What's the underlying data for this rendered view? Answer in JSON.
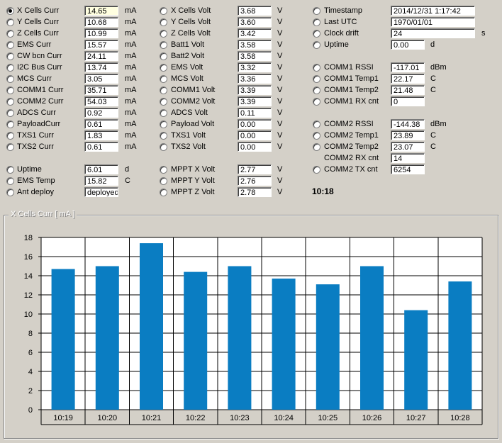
{
  "col1": [
    {
      "label": "X Cells Curr",
      "value": "14.65",
      "unit": "mA",
      "selected": true,
      "highlight": true
    },
    {
      "label": "Y Cells Curr",
      "value": "10.68",
      "unit": "mA"
    },
    {
      "label": "Z Cells Curr",
      "value": "10.99",
      "unit": "mA"
    },
    {
      "label": "EMS Curr",
      "value": "15.57",
      "unit": "mA"
    },
    {
      "label": "CW bcn Curr",
      "value": "24.11",
      "unit": "mA"
    },
    {
      "label": "I2C Bus Curr",
      "value": "13.74",
      "unit": "mA"
    },
    {
      "label": "MCS Curr",
      "value": "3.05",
      "unit": "mA"
    },
    {
      "label": "COMM1 Curr",
      "value": "35.71",
      "unit": "mA"
    },
    {
      "label": "COMM2 Curr",
      "value": "54.03",
      "unit": "mA"
    },
    {
      "label": "ADCS Curr",
      "value": "0.92",
      "unit": "mA"
    },
    {
      "label": "PayloadCurr",
      "value": "0.61",
      "unit": "mA"
    },
    {
      "label": "TXS1 Curr",
      "value": "1.83",
      "unit": "mA"
    },
    {
      "label": "TXS2 Curr",
      "value": "0.61",
      "unit": "mA"
    }
  ],
  "col1b": [
    {
      "label": "Uptime",
      "value": "6.01",
      "unit": "d"
    },
    {
      "label": "EMS Temp",
      "value": "15.82",
      "unit": "C"
    },
    {
      "label": "Ant deploy",
      "value": "deployed",
      "unit": ""
    }
  ],
  "col2": [
    {
      "label": "X Cells Volt",
      "value": "3.68",
      "unit": "V"
    },
    {
      "label": "Y Cells Volt",
      "value": "3.60",
      "unit": "V"
    },
    {
      "label": "Z Cells Volt",
      "value": "3.42",
      "unit": "V"
    },
    {
      "label": "Batt1 Volt",
      "value": "3.58",
      "unit": "V"
    },
    {
      "label": "Batt2 Volt",
      "value": "3.58",
      "unit": "V"
    },
    {
      "label": "EMS Volt",
      "value": "3.32",
      "unit": "V"
    },
    {
      "label": "MCS Volt",
      "value": "3.36",
      "unit": "V"
    },
    {
      "label": "COMM1 Volt",
      "value": "3.39",
      "unit": "V"
    },
    {
      "label": "COMM2 Volt",
      "value": "3.39",
      "unit": "V"
    },
    {
      "label": "ADCS Volt",
      "value": "0.11",
      "unit": "V"
    },
    {
      "label": "Payload Volt",
      "value": "0.00",
      "unit": "V"
    },
    {
      "label": "TXS1 Volt",
      "value": "0.00",
      "unit": "V"
    },
    {
      "label": "TXS2 Volt",
      "value": "0.00",
      "unit": "V"
    }
  ],
  "col2b": [
    {
      "label": "MPPT X Volt",
      "value": "2.77",
      "unit": "V"
    },
    {
      "label": "MPPT Y Volt",
      "value": "2.76",
      "unit": "V"
    },
    {
      "label": "MPPT Z Volt",
      "value": "2.78",
      "unit": "V"
    }
  ],
  "col3a": [
    {
      "label": "Timestamp",
      "value": "2014/12/31 1:17:42",
      "unit": "",
      "radio": true
    },
    {
      "label": "Last UTC",
      "value": "1970/01/01",
      "unit": "",
      "radio": true
    },
    {
      "label": "Clock drift",
      "value": "24",
      "unit": "s",
      "radio": true
    },
    {
      "label": "Uptime",
      "value": "0.00",
      "unit": "d",
      "radio": true
    }
  ],
  "col3b": [
    {
      "label": "COMM1 RSSI",
      "value": "-117.01",
      "unit": "dBm",
      "radio": true
    },
    {
      "label": "COMM1 Temp1",
      "value": "22.17",
      "unit": "C",
      "radio": true
    },
    {
      "label": "COMM1 Temp2",
      "value": "21.48",
      "unit": "C",
      "radio": true
    },
    {
      "label": "COMM1 RX cnt",
      "value": "0",
      "unit": "",
      "radio": true
    }
  ],
  "col3c": [
    {
      "label": "COMM2 RSSI",
      "value": "-144.38",
      "unit": "dBm",
      "radio": true
    },
    {
      "label": "COMM2 Temp1",
      "value": "23.89",
      "unit": "C",
      "radio": true
    },
    {
      "label": "COMM2 Temp2",
      "value": "23.07",
      "unit": "C",
      "radio": true
    },
    {
      "label": "COMM2 RX cnt",
      "value": "14",
      "unit": "",
      "radio": false
    },
    {
      "label": "COMM2 TX cnt",
      "value": "6254",
      "unit": "",
      "radio": true
    }
  ],
  "clock": "10:18",
  "group_title": "X Cells Curr  [ mA ]",
  "colors": {
    "bar": "#0a7dc2",
    "accent": "#ffffe0"
  },
  "chart_data": {
    "type": "bar",
    "title": "",
    "categories": [
      "10:19",
      "10:20",
      "10:21",
      "10:22",
      "10:23",
      "10:24",
      "10:25",
      "10:26",
      "10:27",
      "10:28"
    ],
    "values": [
      14.7,
      15.0,
      17.4,
      14.4,
      15.0,
      13.7,
      13.1,
      15.0,
      10.4,
      13.4
    ],
    "xlabel": "",
    "ylabel": "",
    "ylim": [
      0,
      18
    ],
    "yticks": [
      "0",
      "2",
      "4",
      "6",
      "8",
      "10",
      "12",
      "14",
      "16",
      "18"
    ],
    "grid": true
  }
}
